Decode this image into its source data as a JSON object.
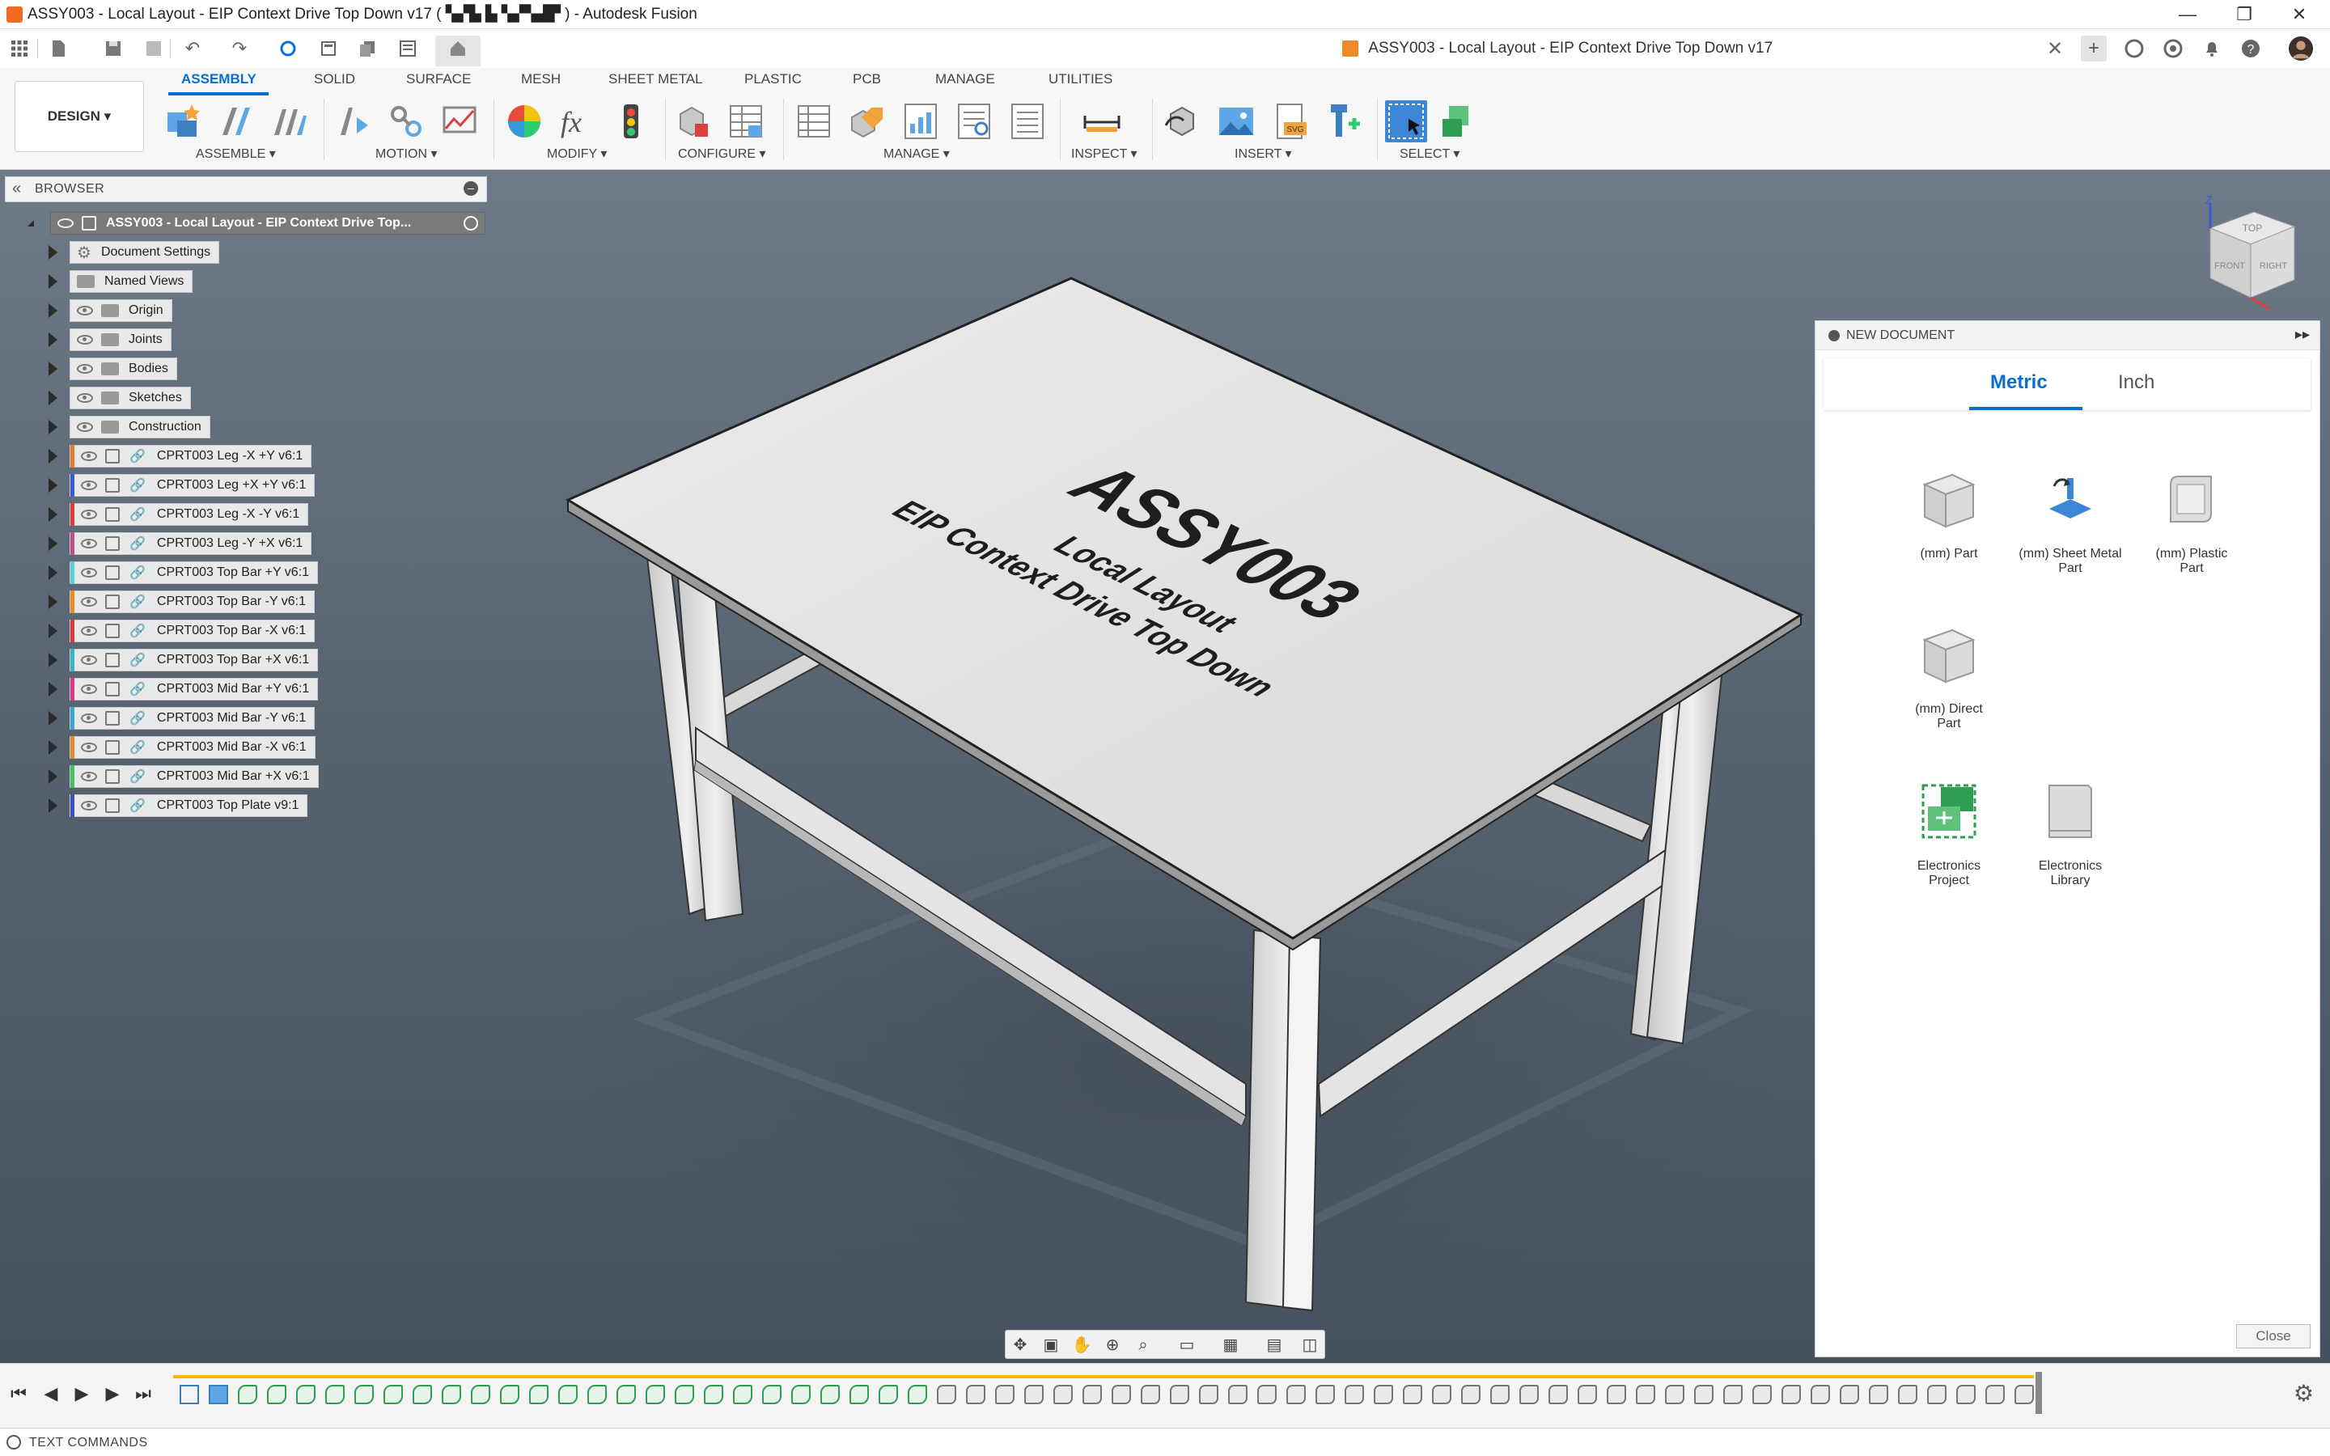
{
  "window": {
    "title": "ASSY003 - Local Layout - EIP Context Drive Top Down v17 ( ▚▞▙ ▙  ▚▞▚▟▛ ) - Autodesk Fusion",
    "minimize": "—",
    "restore": "❐",
    "close": "✕"
  },
  "document_tab": {
    "title": "ASSY003 - Local Layout - EIP Context Drive Top Down v17",
    "close": "✕"
  },
  "ribbon": {
    "workspace": "DESIGN ▾",
    "tabs": [
      "ASSEMBLY",
      "SOLID",
      "SURFACE",
      "MESH",
      "SHEET METAL",
      "PLASTIC",
      "PCB",
      "MANAGE",
      "UTILITIES"
    ],
    "groups": [
      "ASSEMBLE ▾",
      "MOTION ▾",
      "MODIFY ▾",
      "CONFIGURE ▾",
      "MANAGE ▾",
      "INSPECT ▾",
      "INSERT ▾",
      "SELECT ▾"
    ]
  },
  "browser": {
    "title": "BROWSER",
    "root": "ASSY003 - Local Layout - EIP Context Drive Top...",
    "folders": [
      "Document Settings",
      "Named Views",
      "Origin",
      "Joints",
      "Bodies",
      "Sketches",
      "Construction"
    ],
    "components": [
      {
        "label": "CPRT003 Leg -X +Y v6:1",
        "color": "#e57c2e"
      },
      {
        "label": "CPRT003 Leg +X +Y v6:1",
        "color": "#3b5bd6"
      },
      {
        "label": "CPRT003 Leg -X -Y v6:1",
        "color": "#d94040"
      },
      {
        "label": "CPRT003 Leg -Y +X v6:1",
        "color": "#c24d8a"
      },
      {
        "label": "CPRT003 Top Bar +Y v6:1",
        "color": "#5ccfd6"
      },
      {
        "label": "CPRT003 Top Bar -Y v6:1",
        "color": "#ef8a2a"
      },
      {
        "label": "CPRT003 Top Bar -X v6:1",
        "color": "#d93a3a"
      },
      {
        "label": "CPRT003 Top Bar +X v6:1",
        "color": "#39b5c8"
      },
      {
        "label": "CPRT003 Mid Bar +Y v6:1",
        "color": "#d63b8c"
      },
      {
        "label": "CPRT003 Mid Bar -Y v6:1",
        "color": "#3aa6d6"
      },
      {
        "label": "CPRT003 Mid Bar -X v6:1",
        "color": "#e3892c"
      },
      {
        "label": "CPRT003 Mid Bar +X v6:1",
        "color": "#46c06a"
      },
      {
        "label": "CPRT003 Top Plate v9:1",
        "color": "#3a52c4"
      }
    ]
  },
  "model": {
    "line1": "ASSY003",
    "line2": "Local Layout",
    "line3": "EIP Context Drive Top Down"
  },
  "viewcube": {
    "top": "TOP",
    "front": "FRONT",
    "right": "RIGHT",
    "axis_z": "Z"
  },
  "new_document": {
    "title": "NEW DOCUMENT",
    "tabs": {
      "metric": "Metric",
      "inch": "Inch"
    },
    "items": {
      "part": "(mm) Part",
      "sheet_metal_1": "(mm) Sheet Metal",
      "sheet_metal_2": "Part",
      "plastic_1": "(mm) Plastic",
      "plastic_2": "Part",
      "direct_1": "(mm) Direct",
      "direct_2": "Part",
      "elec_project_1": "Electronics",
      "elec_project_2": "Project",
      "elec_library_1": "Electronics",
      "elec_library_2": "Library"
    },
    "close": "Close"
  },
  "text_commands": "TEXT COMMANDS",
  "colors": {
    "accent": "#0a6ed1",
    "timeline": "#ffb400"
  }
}
